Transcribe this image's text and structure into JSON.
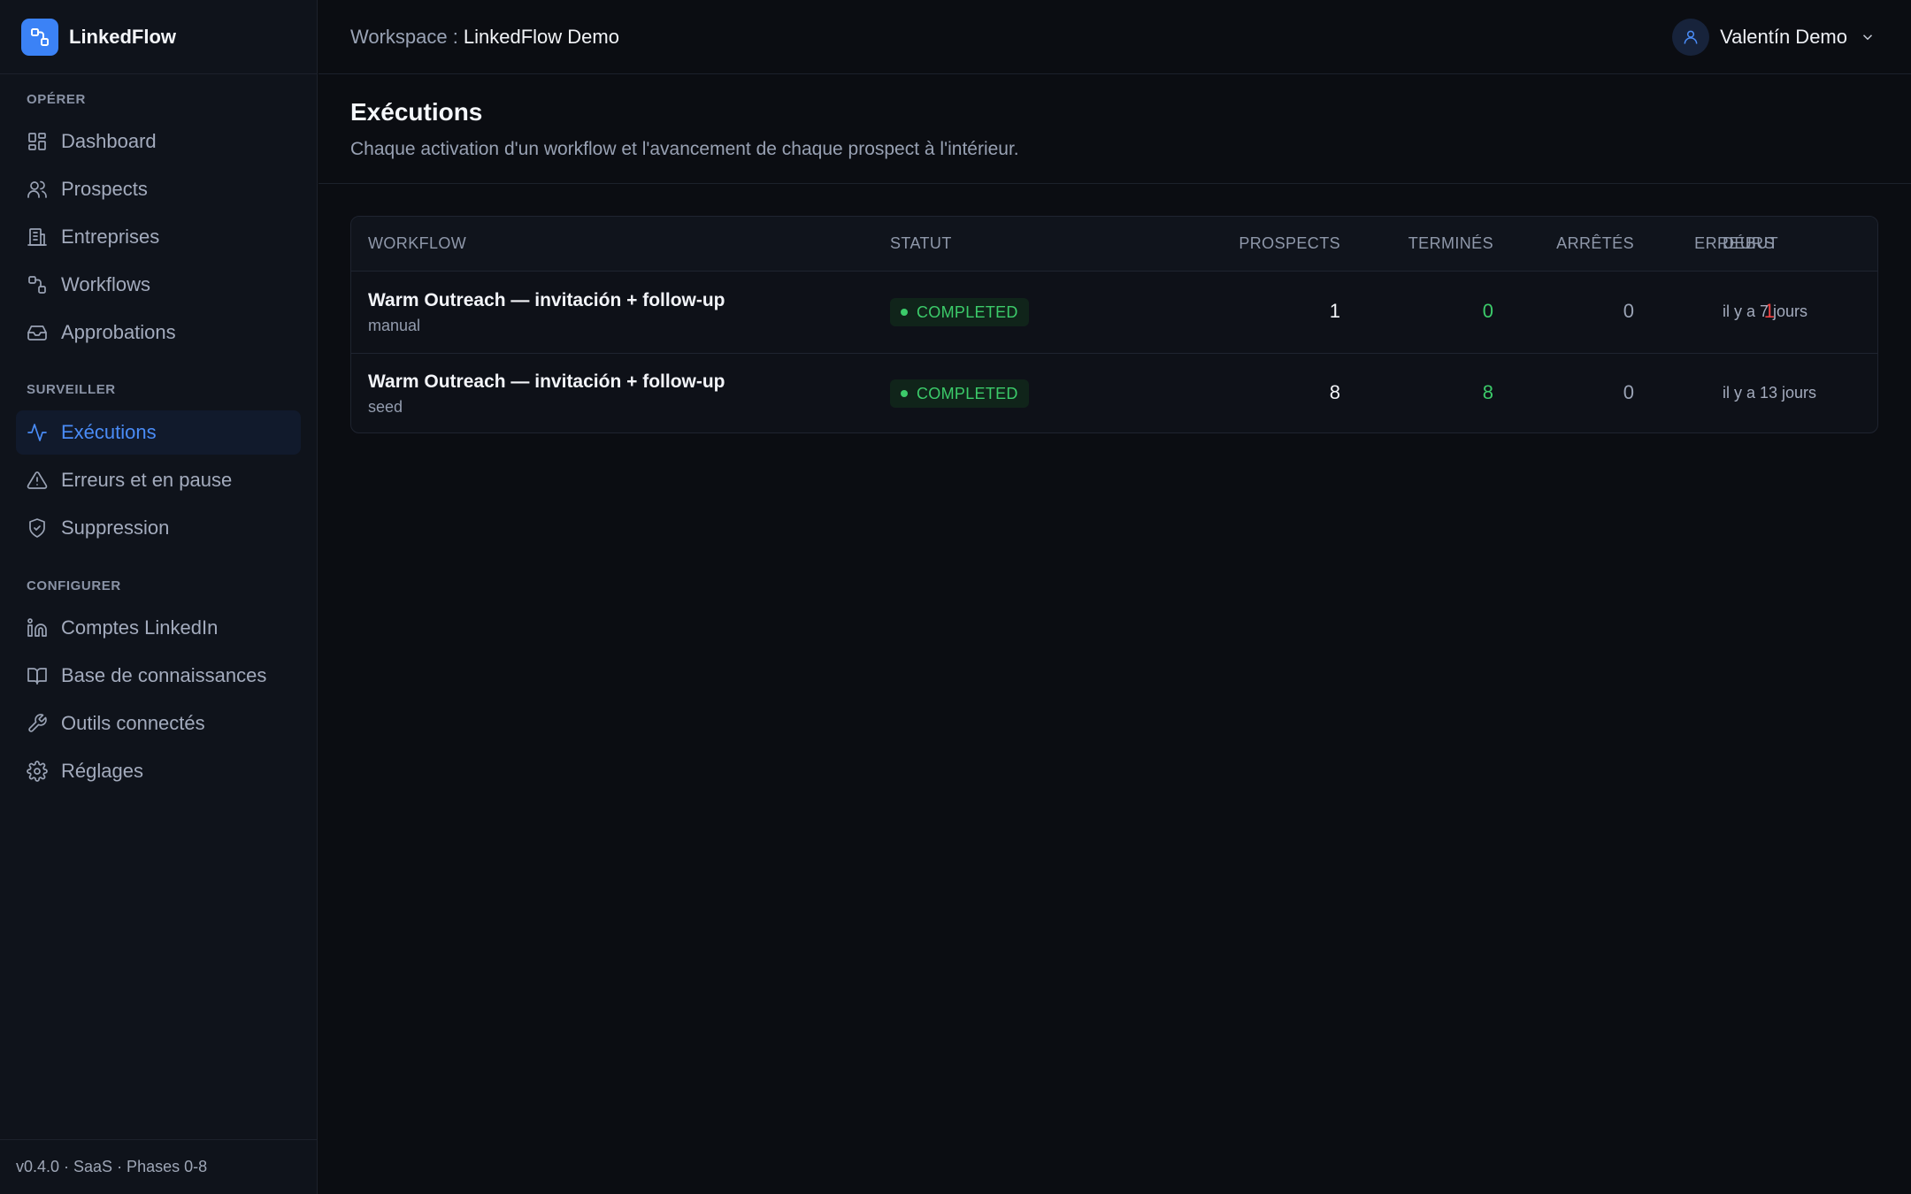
{
  "app": {
    "name": "LinkedFlow",
    "version": "v0.4.0 · SaaS · Phases 0-8"
  },
  "topbar": {
    "workspace_label": "Workspace :",
    "workspace_name": "LinkedFlow Demo",
    "user_name": "Valentín Demo"
  },
  "sidebar": {
    "sections": [
      {
        "label": "OPÉRER"
      },
      {
        "label": "SURVEILLER"
      },
      {
        "label": "CONFIGURER"
      }
    ],
    "items": [
      {
        "label": "Dashboard",
        "icon": "dashboard-icon"
      },
      {
        "label": "Prospects",
        "icon": "users-icon"
      },
      {
        "label": "Entreprises",
        "icon": "building-icon"
      },
      {
        "label": "Workflows",
        "icon": "workflow-icon"
      },
      {
        "label": "Approbations",
        "icon": "inbox-icon"
      },
      {
        "label": "Exécutions",
        "icon": "activity-icon",
        "active": true
      },
      {
        "label": "Erreurs et en pause",
        "icon": "warning-icon"
      },
      {
        "label": "Suppression",
        "icon": "shield-icon"
      },
      {
        "label": "Comptes LinkedIn",
        "icon": "linkedin-icon"
      },
      {
        "label": "Base de connaissances",
        "icon": "book-icon"
      },
      {
        "label": "Outils connectés",
        "icon": "wrench-icon"
      },
      {
        "label": "Réglages",
        "icon": "gear-icon"
      }
    ]
  },
  "page": {
    "title": "Exécutions",
    "subtitle": "Chaque activation d'un workflow et l'avancement de chaque prospect à l'intérieur."
  },
  "table": {
    "columns": [
      "WORKFLOW",
      "STATUT",
      "PROSPECTS",
      "TERMINÉS",
      "ARRÊTÉS",
      "ERREURS",
      "DÉBUT"
    ],
    "rows": [
      {
        "workflow": "Warm Outreach — invitación + follow-up",
        "source": "manual",
        "status": "COMPLETED",
        "prospects": "1",
        "termines": "0",
        "arretes": "0",
        "erreurs": "1",
        "debut": "il y a 7 jours"
      },
      {
        "workflow": "Warm Outreach — invitación + follow-up",
        "source": "seed",
        "status": "COMPLETED",
        "prospects": "8",
        "termines": "8",
        "arretes": "0",
        "erreurs": "",
        "debut": "il y a 13 jours"
      }
    ]
  },
  "colors": {
    "accent": "#3b82f6",
    "success": "#3ccb6a",
    "danger": "#ef4444",
    "background": "#0b0d12"
  }
}
